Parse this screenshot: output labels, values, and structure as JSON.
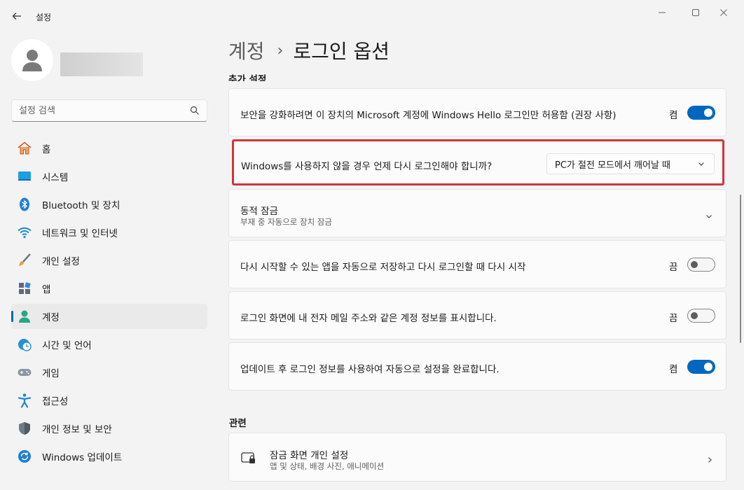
{
  "window": {
    "app_title": "설정",
    "controls": {
      "minimize": "—",
      "maximize": "☐",
      "close": "✕"
    }
  },
  "sidebar": {
    "search_placeholder": "설정 검색",
    "items": [
      {
        "label": "홈",
        "icon": "home-icon"
      },
      {
        "label": "시스템",
        "icon": "system-icon"
      },
      {
        "label": "Bluetooth 및 장치",
        "icon": "bluetooth-icon"
      },
      {
        "label": "네트워크 및 인터넷",
        "icon": "wifi-icon"
      },
      {
        "label": "개인 설정",
        "icon": "brush-icon"
      },
      {
        "label": "앱",
        "icon": "apps-icon"
      },
      {
        "label": "계정",
        "icon": "account-icon",
        "active": true
      },
      {
        "label": "시간 및 언어",
        "icon": "clock-globe-icon"
      },
      {
        "label": "게임",
        "icon": "gamepad-icon"
      },
      {
        "label": "접근성",
        "icon": "accessibility-icon"
      },
      {
        "label": "개인 정보 및 보안",
        "icon": "shield-icon"
      },
      {
        "label": "Windows 업데이트",
        "icon": "update-icon"
      }
    ]
  },
  "breadcrumb": {
    "parent": "계정",
    "separator": "›",
    "current": "로그인 옵션"
  },
  "main": {
    "section_clipped": "추가 설정",
    "hello_only": {
      "label": "보안을 강화하려면 이 장치의 Microsoft 계정에 Windows Hello 로그인만 허용함 (권장 사항)",
      "state": "켬",
      "on": true
    },
    "require_signin": {
      "label": "Windows를 사용하지 않을 경우 언제 다시 로그인해야 합니까?",
      "value": "PC가 절전 모드에서 깨어날 때"
    },
    "dynamic_lock": {
      "label": "동적 잠금",
      "sub": "부재 중 자동으로 장치 잠금"
    },
    "restart_apps": {
      "label": "다시 시작할 수 있는 앱을 자동으로 저장하고 다시 로그인할 때 다시 시작",
      "state": "끔",
      "on": false
    },
    "show_account": {
      "label": "로그인 화면에 내 전자 메일 주소와 같은 계정 정보를 표시합니다.",
      "state": "끔",
      "on": false
    },
    "auto_finish": {
      "label": "업데이트 후 로그인 정보를 사용하여 자동으로 설정을 완료합니다.",
      "state": "켬",
      "on": true
    },
    "related_title": "관련",
    "lockscreen": {
      "label": "잠금 화면 개인 설정",
      "sub": "앱 및 상태, 배경 사진, 애니메이션"
    }
  },
  "colors": {
    "accent": "#0067c0",
    "highlight": "#d13438"
  }
}
